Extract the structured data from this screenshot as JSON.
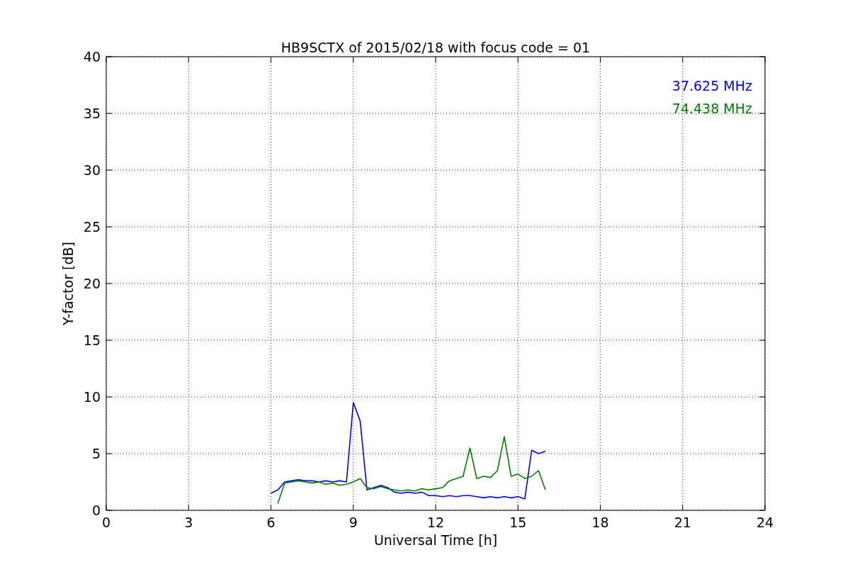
{
  "figure": {
    "chart_data": {
      "type": "line",
      "title": "HB9SCTX of 2015/02/18 with focus code = 01",
      "xlabel": "Universal Time [h]",
      "ylabel": "Y-factor [dB]",
      "x": [
        6,
        6.25,
        6.5,
        6.75,
        7,
        7.25,
        7.5,
        7.75,
        8,
        8.25,
        8.5,
        8.75,
        9,
        9.25,
        9.5,
        9.75,
        10,
        10.25,
        10.5,
        10.75,
        11,
        11.25,
        11.5,
        11.75,
        12,
        12.25,
        12.5,
        12.75,
        13,
        13.25,
        13.5,
        13.75,
        14,
        14.25,
        14.5,
        14.75,
        15,
        15.25,
        15.5,
        15.75,
        16
      ],
      "series": [
        {
          "name": "37.625 MHz",
          "color": "#0000ff",
          "values": [
            1.5,
            1.8,
            2.5,
            2.6,
            2.7,
            2.6,
            2.6,
            2.5,
            2.6,
            2.5,
            2.6,
            2.5,
            9.5,
            7.9,
            1.8,
            2.0,
            2.2,
            2.0,
            1.6,
            1.5,
            1.6,
            1.5,
            1.6,
            1.3,
            1.3,
            1.2,
            1.3,
            1.2,
            1.3,
            1.3,
            1.2,
            1.1,
            1.2,
            1.1,
            1.2,
            1.1,
            1.2,
            1.0,
            5.3,
            5.0,
            5.2
          ]
        },
        {
          "name": "74.438 MHz",
          "color": "#008000",
          "values": [
            null,
            0.6,
            2.4,
            2.5,
            2.6,
            2.5,
            2.4,
            2.5,
            2.3,
            2.4,
            2.2,
            2.3,
            2.5,
            2.8,
            2.0,
            1.9,
            2.1,
            1.9,
            1.8,
            1.7,
            1.8,
            1.7,
            1.9,
            1.8,
            1.9,
            2.0,
            2.6,
            2.8,
            3.0,
            5.5,
            2.8,
            3.0,
            2.9,
            3.5,
            6.5,
            3.0,
            3.2,
            2.8,
            3.0,
            3.5,
            1.8
          ]
        }
      ],
      "xlim": [
        0,
        24
      ],
      "ylim": [
        0,
        40
      ],
      "xticks": [
        0,
        3,
        6,
        9,
        12,
        15,
        18,
        21,
        24
      ],
      "yticks": [
        0,
        5,
        10,
        15,
        20,
        25,
        30,
        35,
        40
      ],
      "grid": true
    }
  }
}
